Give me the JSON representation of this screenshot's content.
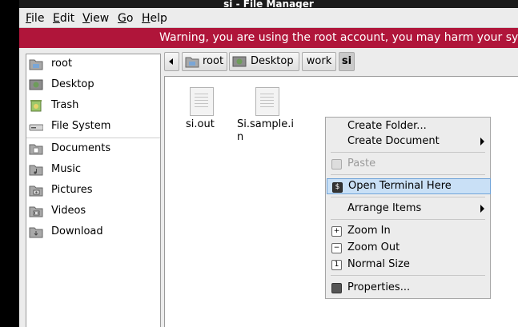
{
  "window": {
    "title": "si - File Manager"
  },
  "menubar": [
    {
      "label": "File",
      "mnemonic": "F",
      "rest": "ile"
    },
    {
      "label": "Edit",
      "mnemonic": "E",
      "rest": "dit"
    },
    {
      "label": "View",
      "mnemonic": "V",
      "rest": "iew"
    },
    {
      "label": "Go",
      "mnemonic": "G",
      "rest": "o"
    },
    {
      "label": "Help",
      "mnemonic": "H",
      "rest": "elp"
    }
  ],
  "warning": "Warning, you are using the root account, you may harm your system.",
  "sidebar": {
    "places": [
      {
        "label": "root",
        "icon": "home-folder-icon"
      },
      {
        "label": "Desktop",
        "icon": "desktop-icon"
      },
      {
        "label": "Trash",
        "icon": "trash-icon"
      },
      {
        "label": "File System",
        "icon": "drive-icon"
      }
    ],
    "bookmarks": [
      {
        "label": "Documents",
        "icon": "documents-folder-icon"
      },
      {
        "label": "Music",
        "icon": "music-folder-icon"
      },
      {
        "label": "Pictures",
        "icon": "pictures-folder-icon"
      },
      {
        "label": "Videos",
        "icon": "videos-folder-icon"
      },
      {
        "label": "Download",
        "icon": "download-folder-icon"
      }
    ]
  },
  "pathbar": {
    "crumbs": [
      "root",
      "Desktop",
      "work",
      "si"
    ],
    "active": "si"
  },
  "files": [
    {
      "name": "si.out",
      "icon": "text-file-icon"
    },
    {
      "name": "Si.sample.in",
      "icon": "text-file-icon"
    }
  ],
  "context_menu": {
    "create_folder": "Create Folder...",
    "create_document": "Create Document",
    "paste": "Paste",
    "open_terminal": "Open Terminal Here",
    "arrange_items": "Arrange Items",
    "zoom_in": "Zoom In",
    "zoom_out": "Zoom Out",
    "normal_size": "Normal Size",
    "properties": "Properties..."
  },
  "colors": {
    "warning_bg": "#b0153a",
    "highlight_bg": "#c9e0f6",
    "highlight_border": "#6fa3d8"
  }
}
